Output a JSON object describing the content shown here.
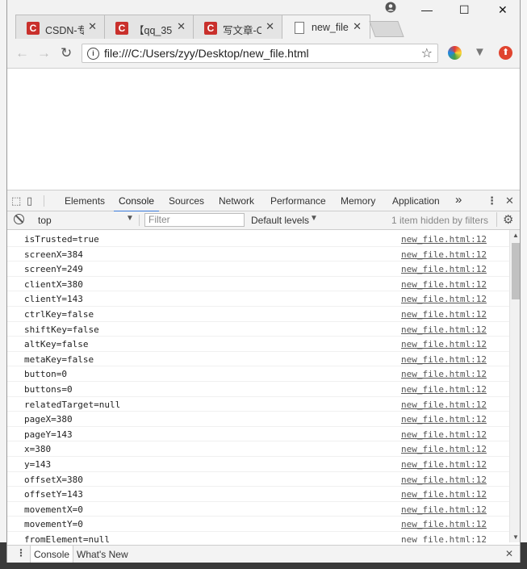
{
  "tabs": [
    {
      "title": "CSDN-专",
      "favicon": "csdn-icon"
    },
    {
      "title": "【qq_35",
      "favicon": "csdn-icon"
    },
    {
      "title": "写文章-C",
      "favicon": "csdn-icon"
    },
    {
      "title": "new_file",
      "favicon": "document-icon",
      "active": true
    }
  ],
  "window_controls": {
    "minimize": "—",
    "maximize": "☐",
    "close": "✕"
  },
  "address_bar": {
    "url": "file:///C:/Users/zyy/Desktop/new_file.html"
  },
  "devtools": {
    "tabs": [
      "Elements",
      "Console",
      "Sources",
      "Network",
      "Performance",
      "Memory",
      "Application"
    ],
    "active_tab": "Console",
    "more": "»",
    "context": "top",
    "filter_placeholder": "Filter",
    "levels": "Default levels",
    "hidden_info": "1 item hidden by filters"
  },
  "console_lines": [
    {
      "msg": "isTrusted=true",
      "src": "new_file.html:12"
    },
    {
      "msg": "screenX=384",
      "src": "new_file.html:12"
    },
    {
      "msg": "screenY=249",
      "src": "new_file.html:12"
    },
    {
      "msg": "clientX=380",
      "src": "new_file.html:12"
    },
    {
      "msg": "clientY=143",
      "src": "new_file.html:12"
    },
    {
      "msg": "ctrlKey=false",
      "src": "new_file.html:12"
    },
    {
      "msg": "shiftKey=false",
      "src": "new_file.html:12"
    },
    {
      "msg": "altKey=false",
      "src": "new_file.html:12"
    },
    {
      "msg": "metaKey=false",
      "src": "new_file.html:12"
    },
    {
      "msg": "button=0",
      "src": "new_file.html:12"
    },
    {
      "msg": "buttons=0",
      "src": "new_file.html:12"
    },
    {
      "msg": "relatedTarget=null",
      "src": "new_file.html:12"
    },
    {
      "msg": "pageX=380",
      "src": "new_file.html:12"
    },
    {
      "msg": "pageY=143",
      "src": "new_file.html:12"
    },
    {
      "msg": "x=380",
      "src": "new_file.html:12"
    },
    {
      "msg": "y=143",
      "src": "new_file.html:12"
    },
    {
      "msg": "offsetX=380",
      "src": "new_file.html:12"
    },
    {
      "msg": "offsetY=143",
      "src": "new_file.html:12"
    },
    {
      "msg": "movementX=0",
      "src": "new_file.html:12"
    },
    {
      "msg": "movementY=0",
      "src": "new_file.html:12"
    },
    {
      "msg": "fromElement=null",
      "src": "new_file.html:12"
    }
  ],
  "drawer": {
    "tabs": [
      "Console",
      "What's New"
    ]
  },
  "colors": {
    "accent": "#3879d9",
    "csdn_red": "#c9302c",
    "adblock": "#e0442f"
  }
}
